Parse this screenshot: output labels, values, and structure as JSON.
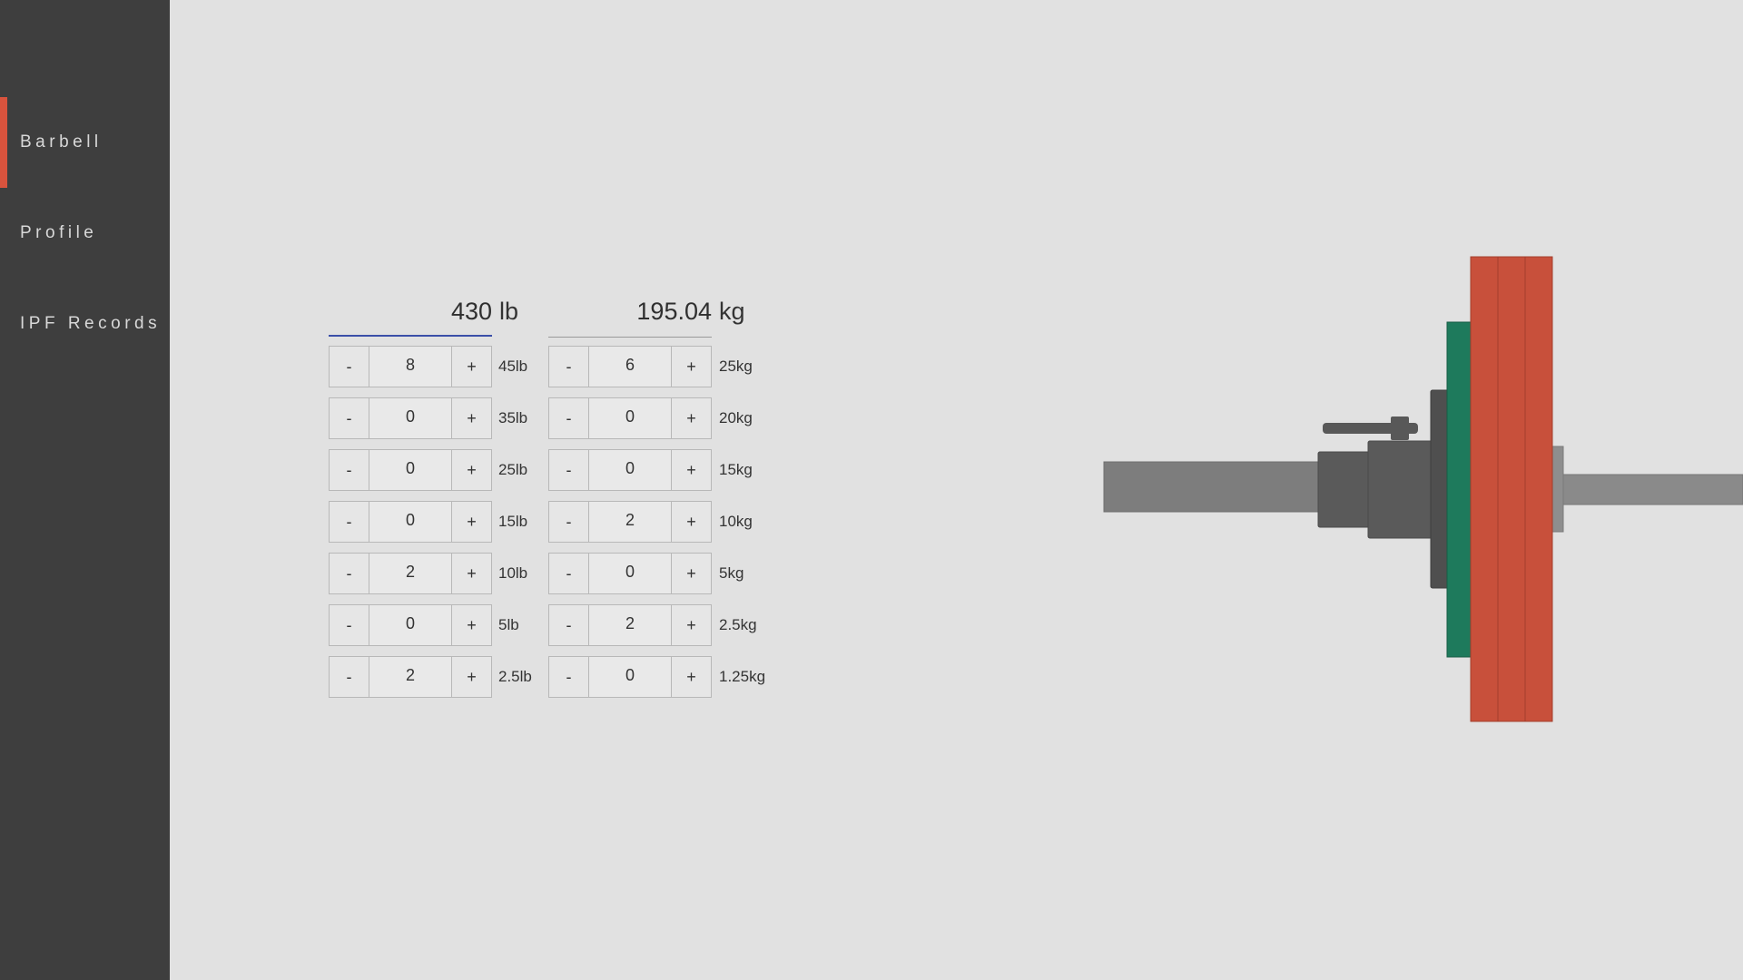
{
  "sidebar": {
    "items": [
      {
        "label": "Barbell",
        "active": true
      },
      {
        "label": "Profile",
        "active": false
      },
      {
        "label": "IPF Records",
        "active": false
      }
    ],
    "accent_color": "#d9533d"
  },
  "totals": {
    "lb_value": "430",
    "lb_unit": "lb",
    "kg_value": "195.04",
    "kg_unit": "kg"
  },
  "lb_plates": [
    {
      "count": "8",
      "label": "45lb"
    },
    {
      "count": "0",
      "label": "35lb"
    },
    {
      "count": "0",
      "label": "25lb"
    },
    {
      "count": "0",
      "label": "15lb"
    },
    {
      "count": "2",
      "label": "10lb"
    },
    {
      "count": "0",
      "label": "5lb"
    },
    {
      "count": "2",
      "label": "2.5lb"
    }
  ],
  "kg_plates": [
    {
      "count": "6",
      "label": "25kg"
    },
    {
      "count": "0",
      "label": "20kg"
    },
    {
      "count": "0",
      "label": "15kg"
    },
    {
      "count": "2",
      "label": "10kg"
    },
    {
      "count": "0",
      "label": "5kg"
    },
    {
      "count": "2",
      "label": "2.5kg"
    },
    {
      "count": "0",
      "label": "1.25kg"
    }
  ],
  "buttons": {
    "minus": "-",
    "plus": "+"
  },
  "visual": {
    "plate_colors": [
      "#c8503b",
      "#1e7a5c",
      "#4f4f4f"
    ],
    "bar_color": "#7d7d7d"
  }
}
